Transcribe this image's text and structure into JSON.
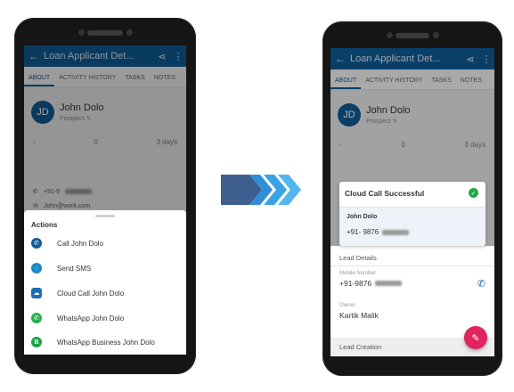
{
  "app": {
    "title": "Loan Applicant Det...",
    "tabs": [
      "ABOUT",
      "ACTIVITY HISTORY",
      "TASKS",
      "NOTES"
    ]
  },
  "contact": {
    "initials": "JD",
    "name": "John Dolo",
    "status": "Prospect",
    "stats": [
      "-",
      "0",
      "3 days"
    ],
    "phone_prefix": "+91-9",
    "email_prefix": "John@work.com"
  },
  "actions_sheet": {
    "title": "Actions",
    "items": [
      {
        "label": "Call John Dolo",
        "icon": "phone-icon",
        "color": "#0f5b95"
      },
      {
        "label": "Send SMS",
        "icon": "sms-icon",
        "color": "#1e88c9"
      },
      {
        "label": "Cloud Call John Dolo",
        "icon": "cloud-call-icon",
        "color": "#1e6fb3"
      },
      {
        "label": "WhatsApp John Dolo",
        "icon": "whatsapp-icon",
        "color": "#21b24b"
      },
      {
        "label": "WhatsApp Business John Dolo",
        "icon": "whatsapp-business-icon",
        "color": "#1f9f46"
      }
    ]
  },
  "cloud_call_card": {
    "title": "Cloud Call Successful",
    "name": "John Dolo",
    "number_prefix": "+91- 9876"
  },
  "lead_details": {
    "title": "Lead Details",
    "mobile_label": "Mobile Number",
    "mobile_prefix": "+91-9876",
    "owner_label": "Owner",
    "owner_value": "Kartik Malik",
    "lead_creation": "Lead Creation"
  },
  "colors": {
    "appbar": "#0f5b95",
    "accent_fab": "#e0245e",
    "success": "#20a84a"
  }
}
